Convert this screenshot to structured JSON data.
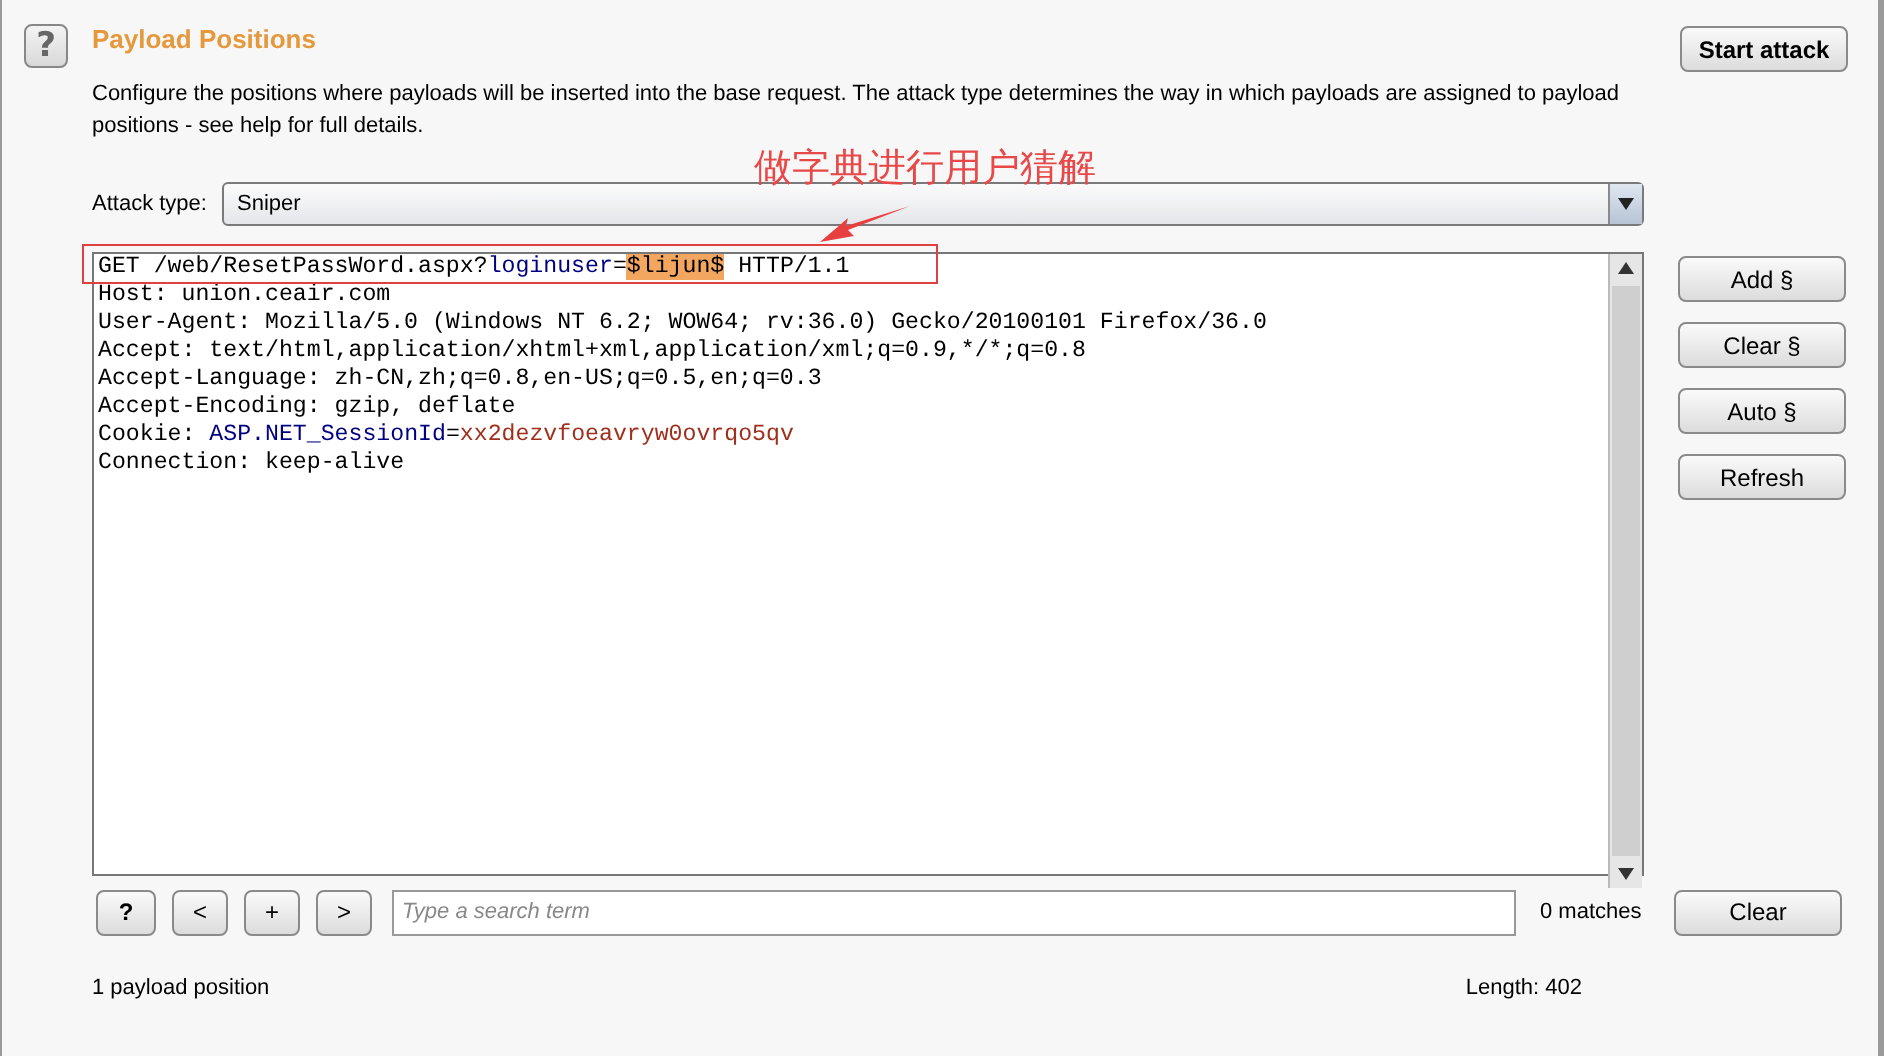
{
  "help_icon": "?",
  "header": {
    "title": "Payload Positions",
    "description": "Configure the positions where payloads will be inserted into the base request. The attack type determines the way in which payloads are assigned to payload positions - see help for full details."
  },
  "start_button": "Start attack",
  "attack_type": {
    "label": "Attack type:",
    "value": "Sniper"
  },
  "request_lines": [
    {
      "segments": [
        {
          "kind": "plain",
          "text": "GET /web/ResetPassWord.aspx?"
        },
        {
          "kind": "param",
          "text": "loginuser"
        },
        {
          "kind": "plain",
          "text": "="
        },
        {
          "kind": "payload",
          "text": "$lijun$"
        },
        {
          "kind": "plain",
          "text": " HTTP/1.1"
        }
      ]
    },
    {
      "segments": [
        {
          "kind": "plain",
          "text": "Host: union.ceair.com"
        }
      ]
    },
    {
      "segments": [
        {
          "kind": "plain",
          "text": "User-Agent: Mozilla/5.0 (Windows NT 6.2; WOW64; rv:36.0) Gecko/20100101 Firefox/36.0"
        }
      ]
    },
    {
      "segments": [
        {
          "kind": "plain",
          "text": "Accept: text/html,application/xhtml+xml,application/xml;q=0.9,*/*;q=0.8"
        }
      ]
    },
    {
      "segments": [
        {
          "kind": "plain",
          "text": "Accept-Language: zh-CN,zh;q=0.8,en-US;q=0.5,en;q=0.3"
        }
      ]
    },
    {
      "segments": [
        {
          "kind": "plain",
          "text": "Accept-Encoding: gzip, deflate"
        }
      ]
    },
    {
      "segments": [
        {
          "kind": "plain",
          "text": "Cookie: "
        },
        {
          "kind": "param",
          "text": "ASP.NET_SessionId"
        },
        {
          "kind": "plain",
          "text": "="
        },
        {
          "kind": "value",
          "text": "xx2dezvfoeavryw0ovrqo5qv"
        }
      ]
    },
    {
      "segments": [
        {
          "kind": "plain",
          "text": "Connection: keep-alive"
        }
      ]
    }
  ],
  "side_buttons": [
    "Add §",
    "Clear §",
    "Auto §",
    "Refresh"
  ],
  "search": {
    "nav_buttons": [
      "?",
      "<",
      "+",
      ">"
    ],
    "placeholder": "Type a search term",
    "matches": "0 matches",
    "clear": "Clear"
  },
  "status": {
    "positions": "1 payload position",
    "length": "Length: 402"
  },
  "annotation": {
    "text": "做字典进行用户猜解"
  }
}
